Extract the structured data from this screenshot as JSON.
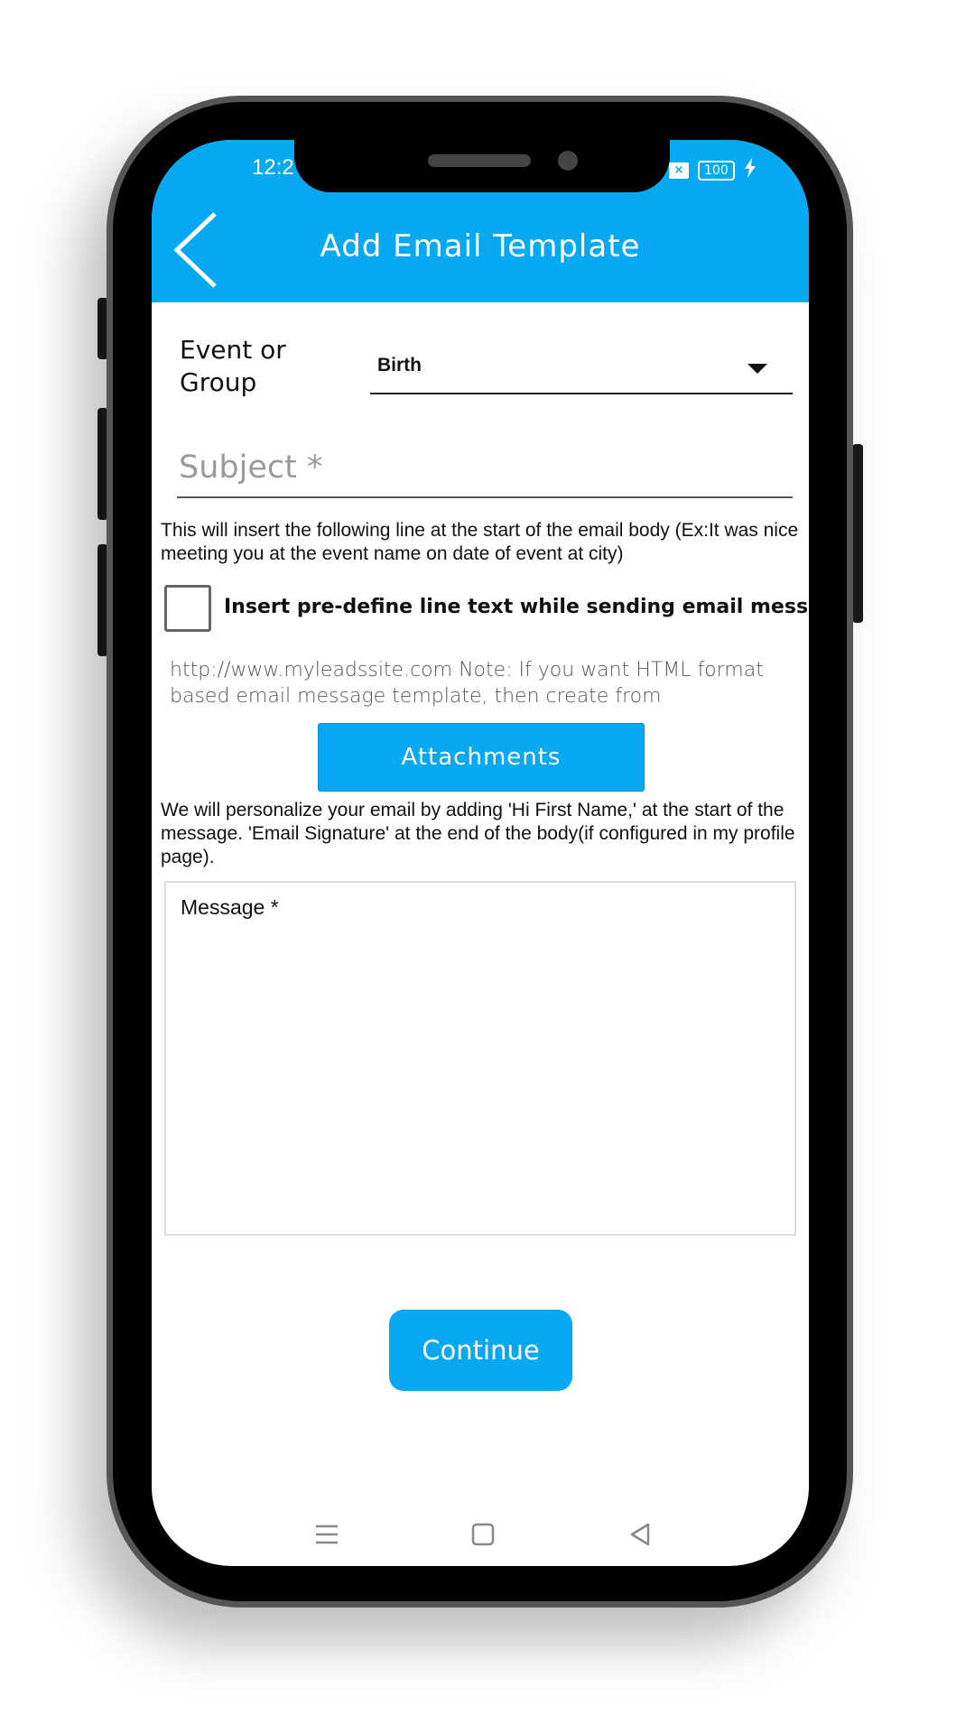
{
  "status_bar": {
    "time": "12:2",
    "close_badge": "×",
    "battery": "100",
    "charging_icon": "bolt-icon"
  },
  "header": {
    "title": "Add Email Template",
    "back_icon": "chevron-left-icon",
    "background_color": "#06a8f1"
  },
  "form": {
    "event_label": "Event or Group",
    "event_selected": "Birth",
    "subject_placeholder": "Subject *",
    "insert_helper": "This will insert the following line at the start of the email body (Ex:It was nice meeting you at the event name on date of event at city)",
    "checkbox_label": "Insert pre-define line text while sending email message",
    "checkbox_checked": false,
    "html_note": "http://www.myleadssite.com Note: If you want HTML format based email message template, then create from",
    "attachments_label": "Attachments",
    "personalize_helper": "We will personalize your email by adding 'Hi First Name,' at the start of the message. 'Email Signature' at the end of the body(if configured in my profile page).",
    "message_placeholder": "Message *",
    "continue_label": "Continue"
  },
  "nav_bar": {
    "menu_icon": "menu-icon",
    "home_icon": "square-home-icon",
    "back_icon": "triangle-back-icon"
  }
}
